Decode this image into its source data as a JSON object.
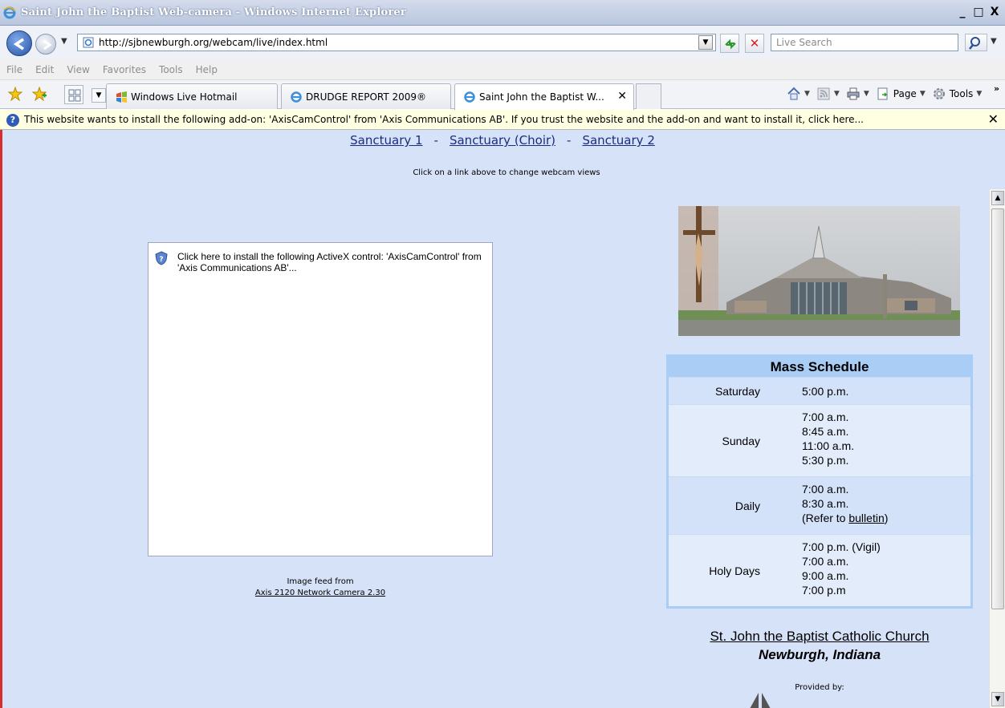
{
  "window": {
    "title": "Saint John the Baptist Web-camera - Windows Internet Explorer",
    "controls": [
      "_",
      "□",
      "X"
    ]
  },
  "address_bar": {
    "url": "http://sjbnewburgh.org/webcam/live/index.html",
    "search_placeholder": "Live Search"
  },
  "menu": [
    "File",
    "Edit",
    "View",
    "Favorites",
    "Tools",
    "Help"
  ],
  "tabs": [
    {
      "label": "Windows Live Hotmail",
      "icon": "hotmail-icon",
      "active": false
    },
    {
      "label": "DRUDGE REPORT 2009®",
      "icon": "ie-page-icon",
      "active": false
    },
    {
      "label": "Saint John the Baptist W...",
      "icon": "ie-page-icon",
      "active": true
    }
  ],
  "command_bar": {
    "page_label": "Page",
    "tools_label": "Tools"
  },
  "info_bar": {
    "message": "This website wants to install the following add-on: 'AxisCamControl' from 'Axis Communications AB'. If you trust the website and the add-on and want to install it, click here..."
  },
  "page": {
    "view_links": [
      "Sanctuary 1",
      "Sanctuary (Choir)",
      "Sanctuary 2"
    ],
    "view_separator": "-",
    "links_hint": "Click on a link above to change webcam views",
    "activex_message": "Click here to install the following ActiveX control: 'AxisCamControl' from 'Axis Communications AB'...",
    "feed_caption": "Image feed from",
    "feed_link": "Axis 2120 Network Camera 2.30",
    "mass_schedule": {
      "title": "Mass Schedule",
      "rows": [
        {
          "day": "Saturday",
          "times": [
            "5:00 p.m."
          ]
        },
        {
          "day": "Sunday",
          "times": [
            "7:00 a.m.",
            "8:45 a.m.",
            "11:00 a.m.",
            "5:30 p.m."
          ]
        },
        {
          "day": "Daily",
          "times": [
            "7:00 a.m.",
            "8:30 a.m."
          ],
          "note_prefix": "(Refer to ",
          "note_link": "bulletin",
          "note_suffix": ")"
        },
        {
          "day": "Holy Days",
          "times": [
            "7:00 p.m. (Vigil)",
            "7:00 a.m.",
            "9:00 a.m.",
            "7:00 p.m"
          ]
        }
      ]
    },
    "church_name": "St. John the Baptist Catholic Church",
    "church_city": "Newburgh, Indiana",
    "provided_by": "Provided by:"
  },
  "colors": {
    "page_background": "#d6e2f8",
    "schedule_header": "#a9cdf4",
    "link": "#1b2c80",
    "info_bar": "#ffffe1"
  }
}
